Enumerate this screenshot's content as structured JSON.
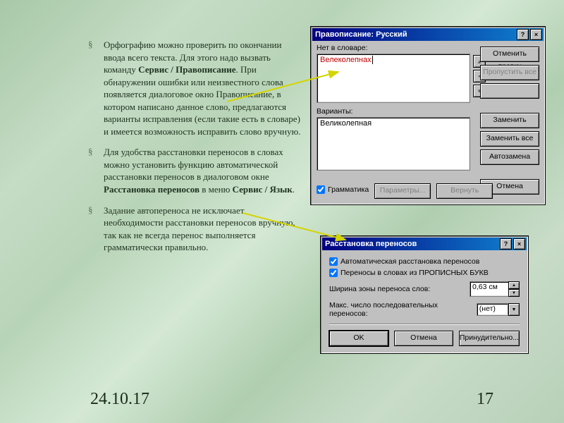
{
  "bullets": [
    {
      "pre": "Орфографию можно проверить по окончании ввода всего текста. Для этого надо вызвать команду ",
      "b1": "Сервис / Правописание",
      "post": ". При обнаружении ошибки или неизвестного слова появляется диалоговое окно Правописание, в котором написано данное слово, предлагаются варианты исправления (если такие есть в словаре) и имеется возможность исправить слово вручную."
    },
    {
      "pre": "Для удобства расстановки переносов в словах можно установить функцию автоматической расстановки переносов в диалоговом окне ",
      "b1": "Расстановка переносов",
      "mid": " в меню ",
      "b2": "Сервис / Язык",
      "post": "."
    },
    {
      "pre": "Задание автопереноса не исключает необходимости расстановки переносов вручную, так как не всегда перенос выполняется грамматически правильно.",
      "b1": "",
      "post": ""
    }
  ],
  "footer": {
    "date": "24.10.17",
    "page": "17"
  },
  "dlg1": {
    "title": "Правописание: Русский",
    "notindict_label": "Нет в словаре:",
    "notindict_value": "Велеколепнах",
    "variants_label": "Варианты:",
    "variants_value": "Великолепная",
    "grammar_check": "Грамматика",
    "btn_params": "Параметры...",
    "btn_revert": "Вернуть",
    "btn_cancel": "Отмена",
    "btn_undo": "Отменить правку",
    "btn_skipall": "Пропустить все",
    "btn_replace": "Заменить",
    "btn_replaceall": "Заменить все",
    "btn_autocorrect": "Автозамена"
  },
  "dlg2": {
    "title": "Расстановка переносов",
    "chk_auto": "Автоматическая расстановка переносов",
    "chk_caps": "Переносы в словах из ПРОПИСНЫХ БУКВ",
    "zone_label": "Ширина зоны переноса слов:",
    "zone_value": "0,63 см",
    "max_label": "Макс. число последовательных переносов:",
    "max_value": "(нет)",
    "btn_ok": "OK",
    "btn_cancel": "Отмена",
    "btn_manual": "Принудительно..."
  }
}
